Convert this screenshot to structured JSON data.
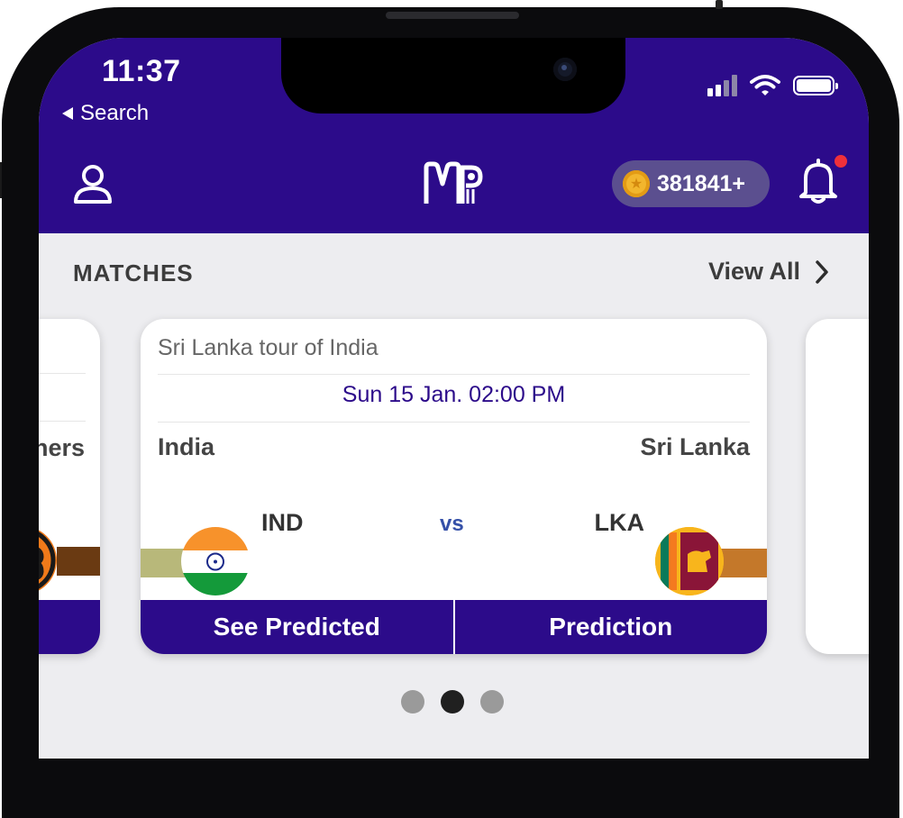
{
  "status_bar": {
    "time": "11:37",
    "back_label": "Search"
  },
  "header": {
    "coins": "381841+",
    "colors": {
      "brand": "#2c0b8a",
      "coin_pill": "#5b4f8f",
      "notification_dot": "#f0303a"
    }
  },
  "matches": {
    "title": "MATCHES",
    "view_all": "View All",
    "left_card_fragment": "ners",
    "card": {
      "tour": "Sri Lanka tour of India",
      "date": "Sun 15 Jan. 02:00 PM",
      "team1": {
        "name": "India",
        "code": "IND"
      },
      "team2": {
        "name": "Sri Lanka",
        "code": "LKA"
      },
      "vs": "vs",
      "see_predicted": "See Predicted",
      "prediction": "Prediction"
    },
    "pagination": {
      "count": 3,
      "active_index": 1
    }
  }
}
